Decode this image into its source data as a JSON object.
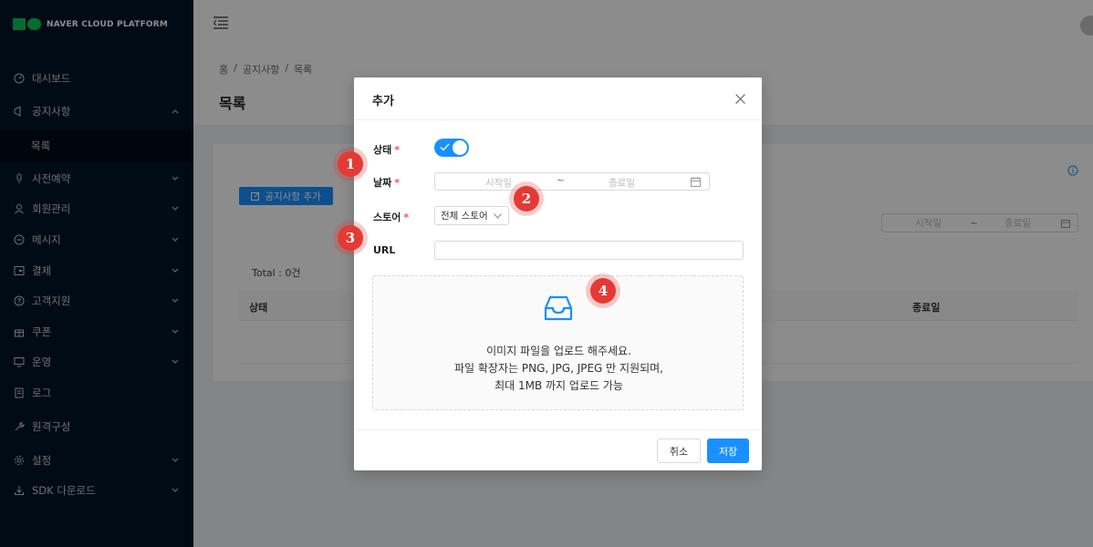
{
  "brand": {
    "name": "NAVER CLOUD PLATFORM",
    "color": "#03c75a"
  },
  "sidebar": {
    "items": [
      {
        "label": "대시보드",
        "icon": "dashboard-icon",
        "expandable": false
      },
      {
        "label": "공지사항",
        "icon": "notice-icon",
        "expandable": true,
        "expanded": true
      },
      {
        "label": "목록",
        "icon": "",
        "sub": true,
        "selected": true
      },
      {
        "label": "사전예약",
        "icon": "microphone-icon",
        "expandable": true
      },
      {
        "label": "회원관리",
        "icon": "user-icon",
        "expandable": true
      },
      {
        "label": "메시지",
        "icon": "message-icon",
        "expandable": true
      },
      {
        "label": "결제",
        "icon": "payment-icon",
        "expandable": true
      },
      {
        "label": "고객지원",
        "icon": "help-icon",
        "expandable": true
      },
      {
        "label": "쿠폰",
        "icon": "gift-icon",
        "expandable": true
      },
      {
        "label": "운영",
        "icon": "desktop-icon",
        "expandable": true
      },
      {
        "label": "로그",
        "icon": "log-icon",
        "expandable": false
      },
      {
        "label": "원격구성",
        "icon": "tool-icon",
        "expandable": false
      },
      {
        "label": "설정",
        "icon": "settings-icon",
        "expandable": true
      },
      {
        "label": "SDK 다운로드",
        "icon": "download-icon",
        "expandable": true
      }
    ]
  },
  "breadcrumb": {
    "home": "홈",
    "section": "공지사항",
    "current": "목록",
    "sep": "/"
  },
  "page": {
    "title": "목록"
  },
  "card": {
    "add_button": "공지사항 추가",
    "range": {
      "start": "시작일",
      "tilde": "~",
      "end": "종료일"
    },
    "total": "Total : 0건",
    "columns": {
      "status": "상태",
      "end_date": "종료일"
    }
  },
  "modal": {
    "title": "추가",
    "fields": {
      "status": {
        "label": "상태",
        "required": "*",
        "value": true
      },
      "date": {
        "label": "날짜",
        "required": "*",
        "start_placeholder": "시작일",
        "tilde": "~",
        "end_placeholder": "종료일"
      },
      "store": {
        "label": "스토어",
        "required": "*",
        "value": "전체 스토어"
      },
      "url": {
        "label": "URL",
        "value": ""
      }
    },
    "upload": {
      "line1": "이미지 파일을 업로드 해주세요.",
      "line2": "파일 확장자는 PNG, JPG, JPEG 만 지원되며,",
      "line3": "최대 1MB 까지 업로드 가능"
    },
    "cancel_label": "취소",
    "save_label": "저장"
  },
  "markers": [
    "1",
    "2",
    "3",
    "4"
  ],
  "colors": {
    "primary": "#1890ff",
    "sidebar_bg": "#001529",
    "marker": "#e53935",
    "required": "#ff4d4f"
  }
}
